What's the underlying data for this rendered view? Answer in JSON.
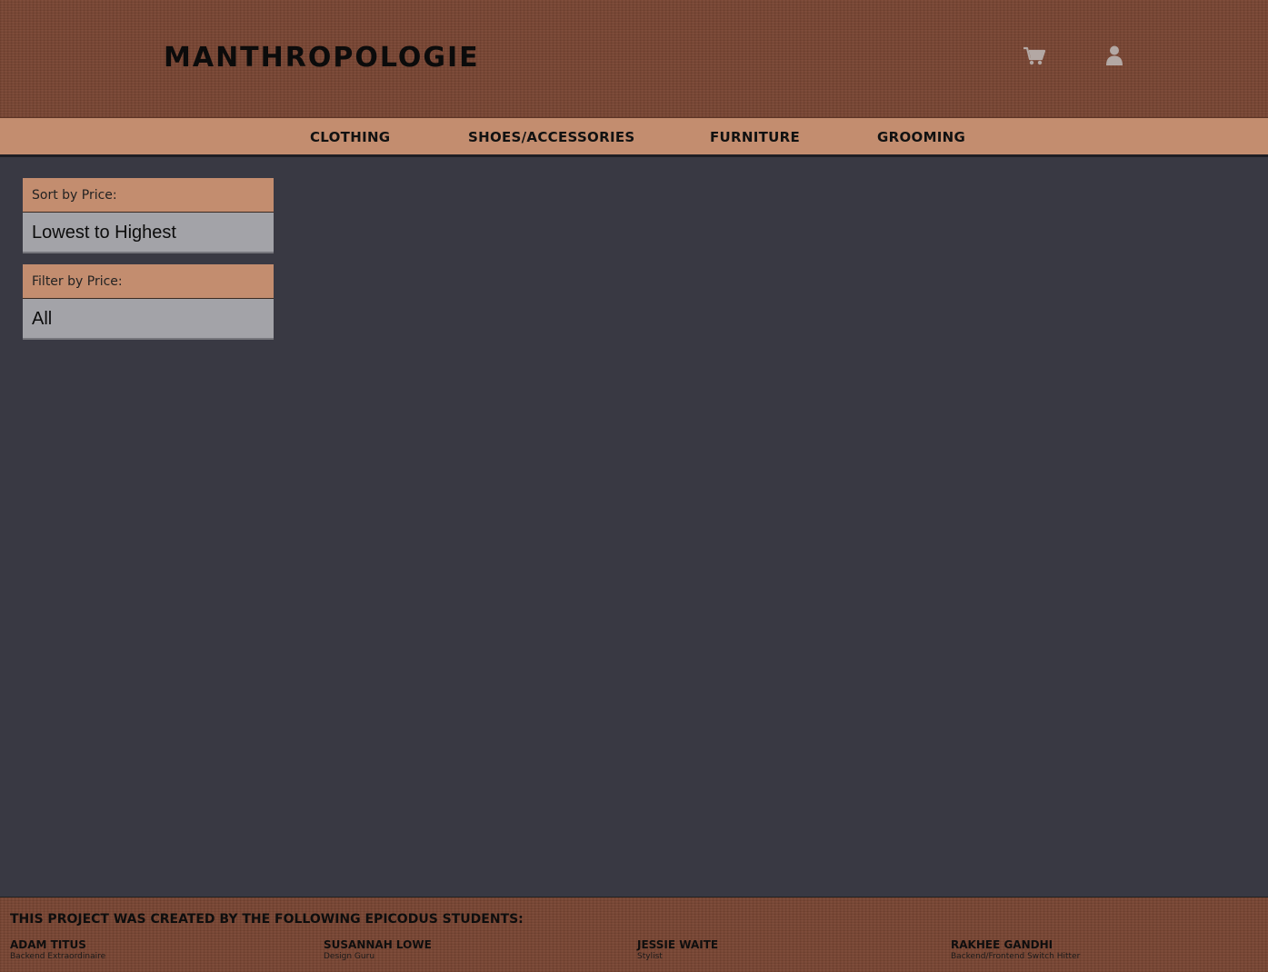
{
  "header": {
    "brand": "MANTHROPOLOGIE",
    "icons": [
      "shopping-cart-icon",
      "user-icon"
    ],
    "icon_color": "#b3a8a4"
  },
  "nav": {
    "items": [
      {
        "label": "CLOTHING"
      },
      {
        "label": "SHOES/ACCESSORIES"
      },
      {
        "label": "FURNITURE"
      },
      {
        "label": "GROOMING"
      }
    ]
  },
  "filters": {
    "sort": {
      "label": "Sort by Price:",
      "value": "Lowest to Highest"
    },
    "filter": {
      "label": "Filter by Price:",
      "value": "All"
    }
  },
  "footer": {
    "title": "THIS PROJECT WAS CREATED BY THE FOLLOWING EPICODUS STUDENTS:",
    "students": [
      {
        "name": "ADAM TITUS",
        "role": "Backend Extraordinaire"
      },
      {
        "name": "SUSANNAH LOWE",
        "role": "Design Guru"
      },
      {
        "name": "JESSIE WAITE",
        "role": "Stylist"
      },
      {
        "name": "RAKHEE GANDHI",
        "role": "Backend/Frontend Switch Hitter"
      }
    ]
  },
  "colors": {
    "wood": "#7b4734",
    "accent": "#c38d6f",
    "background": "#393943",
    "select": "#a3a3a8"
  }
}
